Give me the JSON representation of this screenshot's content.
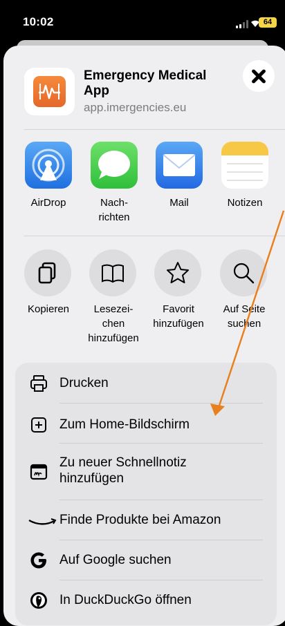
{
  "status": {
    "time": "10:02",
    "battery": "64"
  },
  "app": {
    "title": "Emergency Medical App",
    "url": "app.imergencies.eu"
  },
  "share_targets": [
    {
      "label": "AirDrop"
    },
    {
      "label": "Nach-\nrichten"
    },
    {
      "label": "Mail"
    },
    {
      "label": "Notizen"
    }
  ],
  "actions": [
    {
      "label": "Kopieren"
    },
    {
      "label": "Lesezei-\nchen\nhinzufügen"
    },
    {
      "label": "Favorit\nhinzufügen"
    },
    {
      "label": "Auf Seite\nsuchen"
    }
  ],
  "menu": [
    {
      "label": "Drucken"
    },
    {
      "label": "Zum Home-Bildschirm"
    },
    {
      "label": "Zu neuer Schnellnotiz\nhinzufügen"
    },
    {
      "label": "Finde Produkte bei Amazon"
    },
    {
      "label": "Auf Google suchen"
    },
    {
      "label": "In DuckDuckGo öffnen"
    }
  ],
  "colors": {
    "annotation_arrow": "#e8801f",
    "sheet": "#efeff1",
    "battery": "#f5d44a"
  }
}
